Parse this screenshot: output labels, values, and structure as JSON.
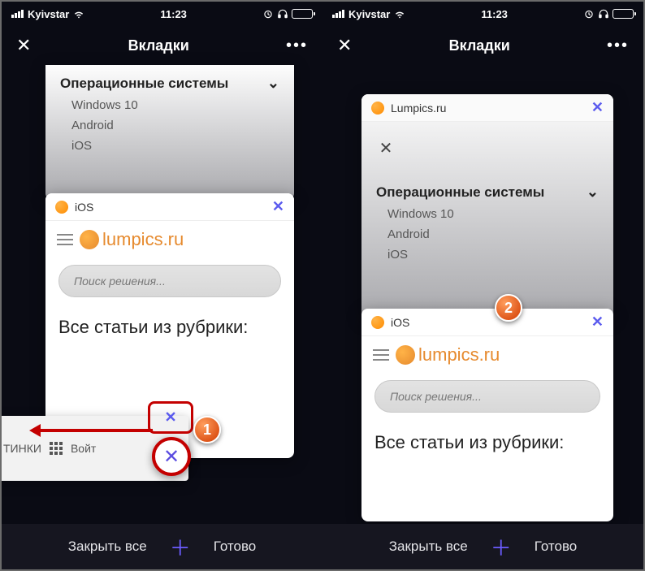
{
  "status": {
    "carrier": "Kyivstar",
    "time": "11:23"
  },
  "nav": {
    "title": "Вкладки"
  },
  "menu": {
    "header": "Операционные системы",
    "items": [
      "Windows 10",
      "Android",
      "iOS"
    ]
  },
  "tab": {
    "title_ios": "iOS",
    "title_lumpics": "Lumpics.ru",
    "site_brand": "lumpics.ru",
    "search_placeholder": "Поиск решения...",
    "heading": "Все статьи из рубрики:"
  },
  "smallcard": {
    "label_pics": "ТИНКИ",
    "label_login": "Войт"
  },
  "bottom": {
    "close_all": "Закрыть все",
    "done": "Готово"
  },
  "badges": {
    "one": "1",
    "two": "2"
  }
}
